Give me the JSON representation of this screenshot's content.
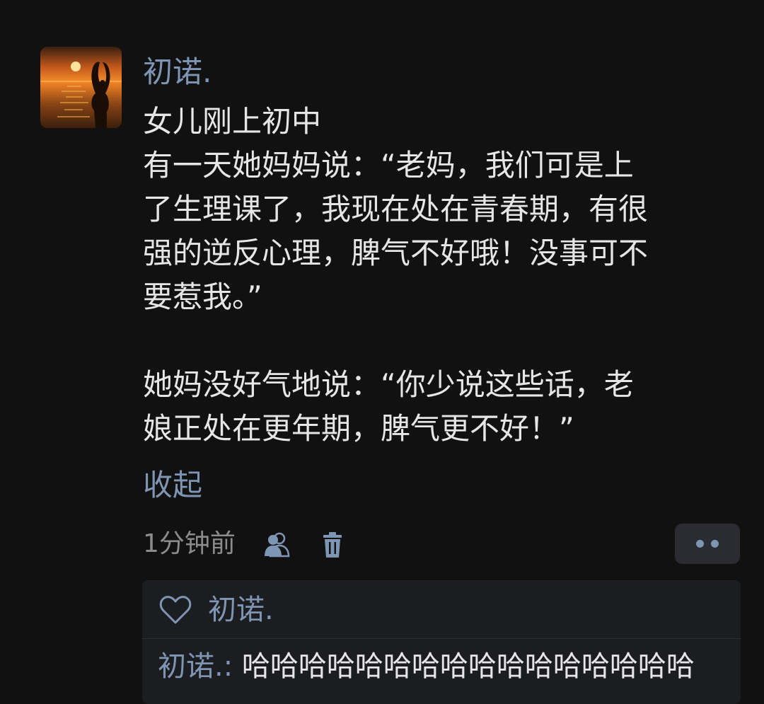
{
  "post": {
    "username": "初诺.",
    "avatar_icon": "sunset-silhouette-avatar",
    "paragraphs": [
      [
        "女儿刚上初中",
        "有一天她妈妈说：“老妈，我们可是上",
        "了生理课了，我现在处在青春期，有很",
        "强的逆反心理，脾气不好哦！没事可不",
        "要惹我。”"
      ],
      [
        "她妈没好气地说：“你少说这些话，老",
        "娘正处在更年期，脾气更不好！”"
      ]
    ],
    "collapse_label": "收起",
    "timestamp": "1分钟前",
    "visibility_icon": "people-icon",
    "delete_icon": "trash-icon",
    "more_icon": "more-dots-icon"
  },
  "interactions": {
    "like_icon": "heart-icon",
    "liker": "初诺.",
    "comment": {
      "author": "初诺.",
      "separator": ":",
      "text": "哈哈哈哈哈哈哈哈哈哈哈哈哈哈哈哈"
    }
  },
  "colors": {
    "background": "#111111",
    "link": "#7f95b4",
    "text": "#e6e6e6",
    "muted": "#8c8c8c",
    "panel": "#1c1d21"
  }
}
